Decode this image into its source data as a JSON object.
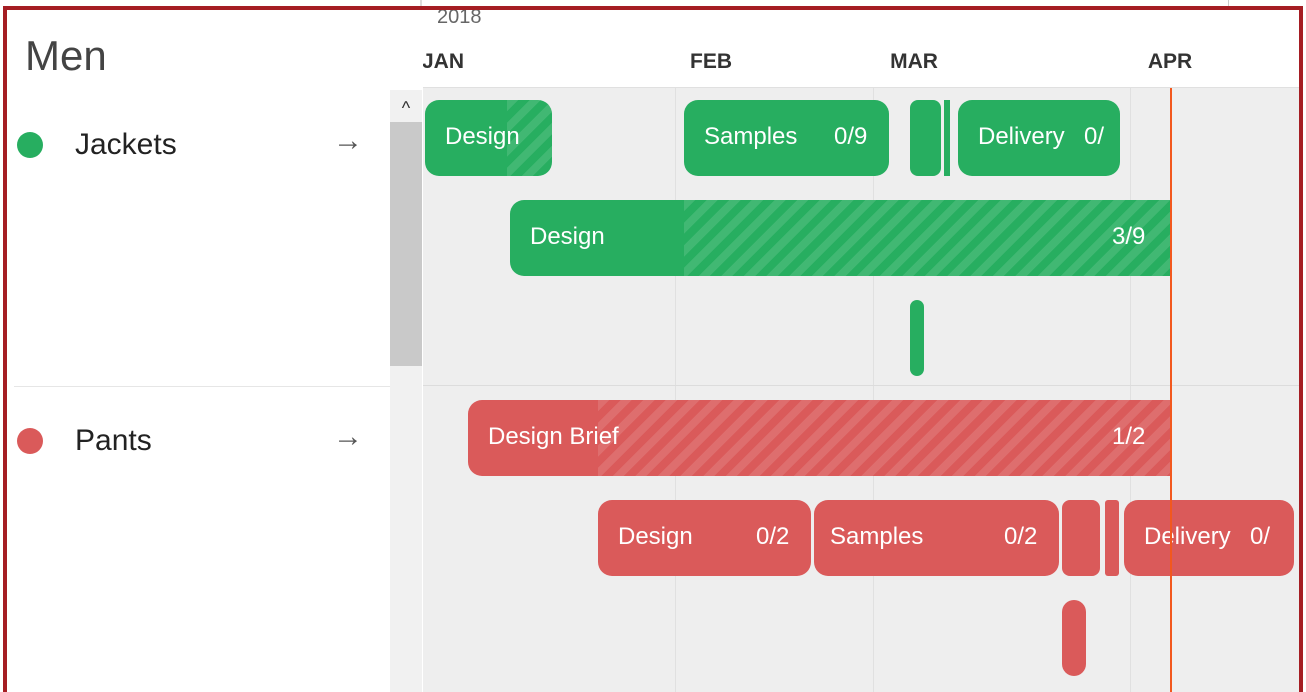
{
  "group": {
    "title": "Men"
  },
  "categories": [
    {
      "name": "Jackets",
      "color": "#27ae60",
      "arrow": "→"
    },
    {
      "name": "Pants",
      "color": "#da5a5a",
      "arrow": "→"
    }
  ],
  "scrollbar": {
    "up_glyph": "^"
  },
  "timeline": {
    "year": "2018",
    "months": [
      "JAN",
      "FEB",
      "MAR",
      "APR"
    ],
    "today_color": "#f2581e"
  },
  "tasks": {
    "jackets_row1": [
      {
        "label": "Design",
        "count": ""
      },
      {
        "label": "Samples",
        "count": "0/9"
      },
      {
        "label": "Delivery",
        "count": "0/"
      }
    ],
    "jackets_row2": [
      {
        "label": "Design",
        "count": "3/9"
      }
    ],
    "pants_row1": [
      {
        "label": "Design Brief",
        "count": "1/2"
      }
    ],
    "pants_row2": [
      {
        "label": "Design",
        "count": "0/2"
      },
      {
        "label": "Samples",
        "count": "0/2"
      },
      {
        "label": "Delivery",
        "count": "0/"
      }
    ]
  }
}
